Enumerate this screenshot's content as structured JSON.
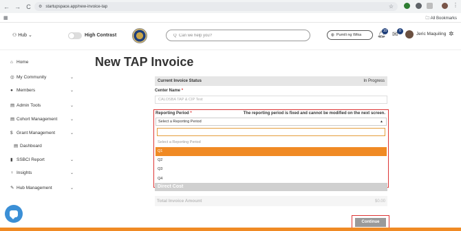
{
  "browser": {
    "nav_back": "←",
    "nav_forward": "→",
    "nav_reload": "C",
    "url": "startupspace.app/new-invoice-tap",
    "all_bookmarks": "All Bookmarks"
  },
  "header": {
    "hub_label": "Hub",
    "high_contrast_label": "High Contrast",
    "search_placeholder": "Q  Can we help you?",
    "language_label": "Pumili ng Wika",
    "notif_count": "10",
    "msg_count": "0",
    "user_name": "Jeric Maquiling"
  },
  "sidebar": {
    "items": [
      {
        "label": "Home",
        "icon": "home-icon",
        "glyph": "⌂",
        "chevron": false
      },
      {
        "label": "My Community",
        "icon": "community-icon",
        "glyph": "◎",
        "chevron": true
      },
      {
        "label": "Members",
        "icon": "members-icon",
        "glyph": "●",
        "chevron": true
      },
      {
        "label": "Admin Tools",
        "icon": "admin-tools-icon",
        "glyph": "▤",
        "chevron": true
      },
      {
        "label": "Cohort Management",
        "icon": "cohort-icon",
        "glyph": "▤",
        "chevron": true
      },
      {
        "label": "Grant Management",
        "icon": "grant-icon",
        "glyph": "$",
        "chevron": true
      },
      {
        "label": "Dashboard",
        "icon": "dashboard-icon",
        "glyph": "▤",
        "chevron": false
      },
      {
        "label": "SSBCI Report",
        "icon": "report-icon",
        "glyph": "▮",
        "chevron": true
      },
      {
        "label": "Insights",
        "icon": "insights-icon",
        "glyph": "♀",
        "chevron": true
      },
      {
        "label": "Hub Management",
        "icon": "hub-management-icon",
        "glyph": "✎",
        "chevron": true
      }
    ]
  },
  "main": {
    "title": "New TAP Invoice",
    "status_label": "Current Invoice Status",
    "status_value": "In Progress",
    "center_label": "Center Name",
    "center_value": "CALOSBA TAP & CIP Test",
    "reporting_period_label": "Reporting Period",
    "reporting_period_note": "The reporting period is fixed and cannot be modified on the next screen.",
    "select_value": "Select a Reporting Period",
    "options": [
      "Select a Reporting Period",
      "Q1",
      "Q2",
      "Q3",
      "Q4"
    ],
    "selected_option": "Q1",
    "direct_cost_label": "Direct Cost",
    "total_label": "Total Invoice Amount",
    "total_value": "$0.00",
    "continue_label": "Continue"
  },
  "colors": {
    "accent": "#f08a24",
    "highlight_border": "#d33333",
    "chat_fab": "#3b8fd6"
  }
}
